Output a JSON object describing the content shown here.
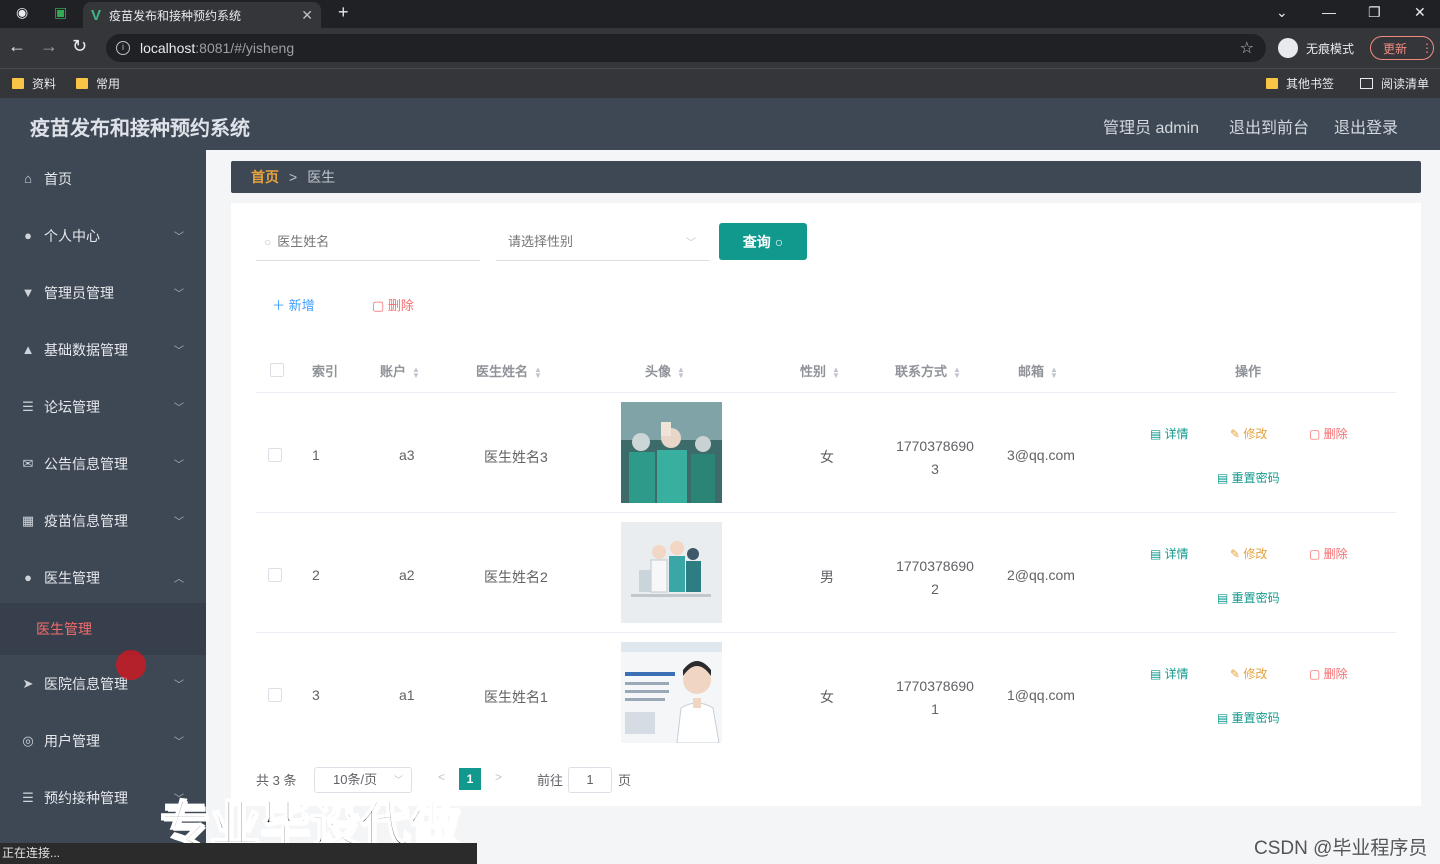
{
  "browser": {
    "tab_title": "疫苗发布和接种预约系统",
    "url_host": "localhost",
    "url_rest": ":8081/#/yisheng",
    "incognito_label": "无痕模式",
    "update_label": "更新",
    "bookmarks": [
      "资料",
      "常用"
    ],
    "bookmarks_right": [
      "其他书签",
      "阅读清单"
    ]
  },
  "header": {
    "title": "疫苗发布和接种预约系统",
    "user": "管理员 admin",
    "front_link": "退出到前台",
    "logout_link": "退出登录"
  },
  "sidebar": {
    "items": [
      {
        "label": "首页",
        "icon": "home-icon"
      },
      {
        "label": "个人中心",
        "icon": "user-icon"
      },
      {
        "label": "管理员管理",
        "icon": "admin-icon"
      },
      {
        "label": "基础数据管理",
        "icon": "thumb-icon"
      },
      {
        "label": "论坛管理",
        "icon": "list-icon"
      },
      {
        "label": "公告信息管理",
        "icon": "mail-icon"
      },
      {
        "label": "疫苗信息管理",
        "icon": "grid-icon"
      },
      {
        "label": "医生管理",
        "icon": "user-icon"
      },
      {
        "label": "医院信息管理",
        "icon": "send-icon"
      },
      {
        "label": "用户管理",
        "icon": "circle-icon"
      },
      {
        "label": "预约接种管理",
        "icon": "list-icon"
      }
    ],
    "active_sub": "医生管理"
  },
  "breadcrumb": {
    "home": "首页",
    "current": "医生"
  },
  "search": {
    "name_placeholder": "医生姓名",
    "gender_placeholder": "请选择性别",
    "query_label": "查询"
  },
  "actions": {
    "add_label": "新增",
    "delete_label": "删除"
  },
  "table": {
    "headers": [
      "索引",
      "账户",
      "医生姓名",
      "头像",
      "性别",
      "联系方式",
      "邮箱",
      "操作"
    ],
    "rows": [
      {
        "index": "1",
        "account": "a3",
        "name": "医生姓名3",
        "gender": "女",
        "phone1": "1770378690",
        "phone2": "3",
        "email": "3@qq.com"
      },
      {
        "index": "2",
        "account": "a2",
        "name": "医生姓名2",
        "gender": "男",
        "phone1": "1770378690",
        "phone2": "2",
        "email": "2@qq.com"
      },
      {
        "index": "3",
        "account": "a1",
        "name": "医生姓名1",
        "gender": "女",
        "phone1": "1770378690",
        "phone2": "1",
        "email": "1@qq.com"
      }
    ],
    "op_labels": {
      "detail": "详情",
      "edit": "修改",
      "delete": "删除",
      "reset": "重置密码"
    }
  },
  "pagination": {
    "total": "共 3 条",
    "page_size": "10条/页",
    "current_page": "1",
    "goto_label": "前往",
    "goto_value": "1",
    "page_unit": "页"
  },
  "overlay": {
    "watermark": "专业毕设代做",
    "status": "正在连接...",
    "csdn": "CSDN @毕业程序员"
  },
  "colors": {
    "sidebar": "#3e4855",
    "accent": "#11998e",
    "active": "#f56c6c"
  }
}
